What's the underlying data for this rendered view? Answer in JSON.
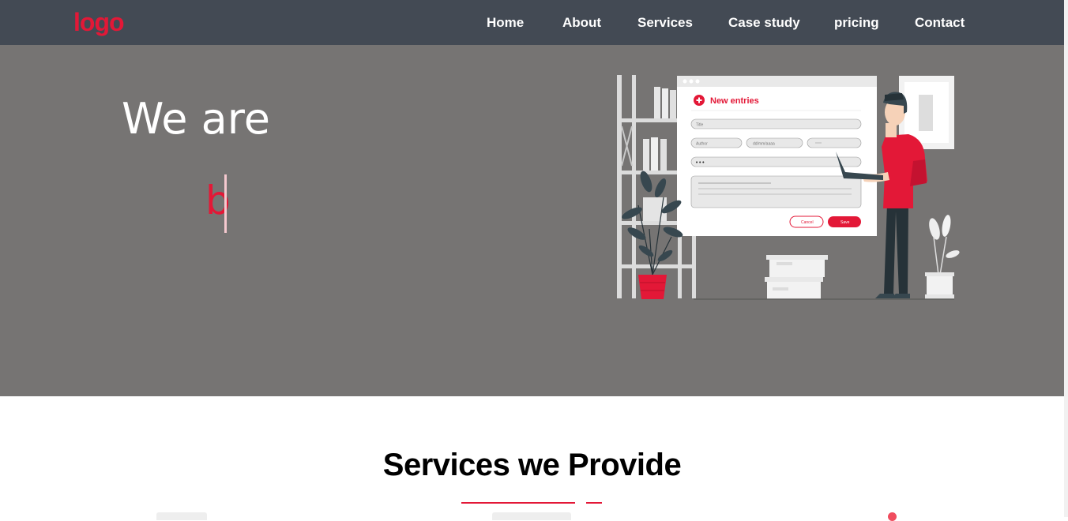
{
  "header": {
    "logo": "logo",
    "nav": [
      "Home",
      "About",
      "Services",
      "Case study",
      "pricing",
      "Contact"
    ]
  },
  "hero": {
    "title": "We are",
    "typed_text": "b",
    "illustration": {
      "heading": "New entries",
      "title_placeholder": "Title",
      "author_placeholder": "Author",
      "date_placeholder": "dd/mm/aaaa",
      "dots": "•••",
      "cancel_label": "Cancel",
      "save_label": "Save"
    }
  },
  "services": {
    "title": "Services we Provide"
  },
  "colors": {
    "accent": "#e31837",
    "navbar": "#434a54",
    "hero_bg": "#767473"
  }
}
